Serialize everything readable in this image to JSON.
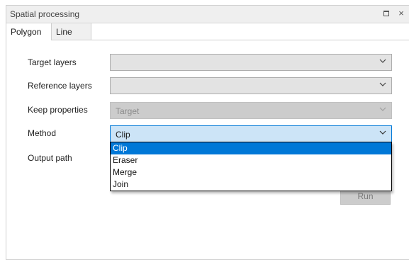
{
  "window": {
    "title": "Spatial processing",
    "maximize_icon": "maximize-icon",
    "close_glyph": "×"
  },
  "tabs": [
    {
      "label": "Polygon",
      "active": true
    },
    {
      "label": "Line",
      "active": false
    }
  ],
  "form": {
    "target_layers": {
      "label": "Target layers",
      "value": ""
    },
    "reference_layers": {
      "label": "Reference layers",
      "value": ""
    },
    "keep_properties": {
      "label": "Keep properties",
      "value": "Target",
      "disabled": true
    },
    "method": {
      "label": "Method",
      "value": "Clip",
      "open": true
    },
    "output_path": {
      "label": "Output path"
    }
  },
  "method_options": [
    "Clip",
    "Eraser",
    "Merge",
    "Join"
  ],
  "run_label": "Run",
  "colors": {
    "accent": "#0078d7",
    "active_combo_bg": "#cce4f7",
    "disabled_bg": "#cccccc"
  }
}
